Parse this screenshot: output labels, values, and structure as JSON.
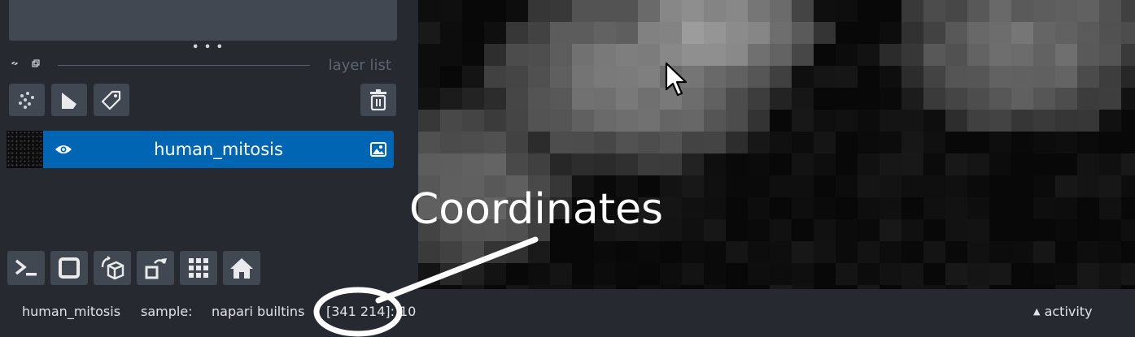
{
  "layer_list": {
    "header_label": "layer list"
  },
  "layer_controls": {
    "points_button": "new-points-layer-icon",
    "shapes_button": "new-shapes-layer-icon",
    "labels_button": "new-labels-layer-icon",
    "delete_button": "delete-layer-icon"
  },
  "layers": [
    {
      "name": "human_mitosis",
      "visible": true,
      "type_icon": "image-icon",
      "selected": true
    }
  ],
  "viewer_buttons": [
    "console-icon",
    "ndisplay-square-icon",
    "roll-dims-icon",
    "transpose-icon",
    "grid-icon",
    "home-icon"
  ],
  "status": {
    "layer": "human_mitosis",
    "source_label": "sample:",
    "source": "napari builtins",
    "coordinates": "[341 214]:",
    "value": "10",
    "activity": "activity"
  },
  "annotation": {
    "text": "Coordinates"
  },
  "colors": {
    "accent": "#0066b3",
    "panel": "#262930",
    "button": "#414851"
  }
}
